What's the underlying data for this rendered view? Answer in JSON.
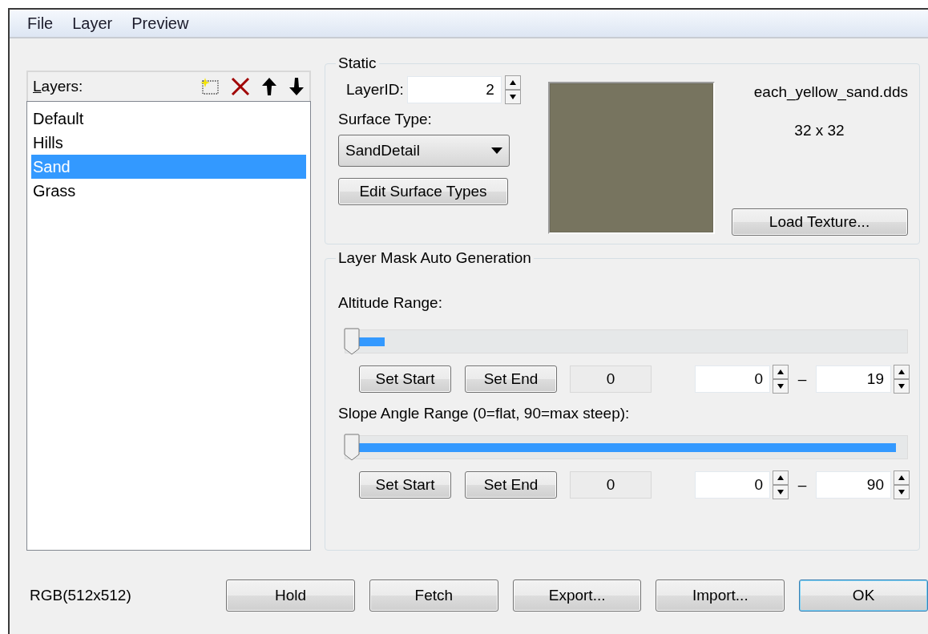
{
  "menu": [
    {
      "label": "File"
    },
    {
      "label": "Layer"
    },
    {
      "label": "Preview"
    }
  ],
  "layers": {
    "title": "Layers:",
    "items": [
      {
        "label": "Default",
        "selected": false
      },
      {
        "label": "Hills",
        "selected": false
      },
      {
        "label": "Sand",
        "selected": true
      },
      {
        "label": "Grass",
        "selected": false
      }
    ]
  },
  "static": {
    "title": "Static",
    "layer_id": {
      "label": "LayerID:",
      "value": "2"
    },
    "surface_type": {
      "label": "Surface Type:",
      "value": "SandDetail"
    },
    "edit_button": "Edit Surface Types",
    "texture": {
      "filename": "each_yellow_sand.dds",
      "size": "32 x 32"
    },
    "load_button": "Load Texture..."
  },
  "mask": {
    "title": "Layer Mask Auto Generation",
    "ranges": [
      {
        "label": "Altitude Range:",
        "level": 0.07,
        "set_start": "Set Start",
        "set_end": "Set End",
        "reading": "0",
        "from": "0",
        "separator": "–",
        "to": "19"
      },
      {
        "label": "Slope Angle Range (0=flat, 90=max steep):",
        "level": 0.98,
        "set_start": "Set Start",
        "set_end": "Set End",
        "reading": "0",
        "from": "0",
        "separator": "–",
        "to": "90"
      }
    ]
  },
  "status": "RGB(512x512)",
  "buttons": [
    {
      "label": "Hold",
      "default": false
    },
    {
      "label": "Fetch",
      "default": false
    },
    {
      "label": "Export...",
      "default": false
    },
    {
      "label": "Import...",
      "default": false
    },
    {
      "label": "OK",
      "default": true
    }
  ]
}
